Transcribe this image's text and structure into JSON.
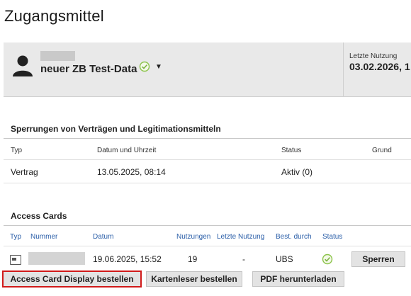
{
  "page": {
    "title": "Zugangsmittel"
  },
  "user_panel": {
    "name": "neuer ZB Test-Data",
    "last_use_label": "Letzte Nutzung",
    "last_use_value": "03.02.2026, 1",
    "colors": {
      "panel_bg": "#e9e9e9",
      "verified": "#8bc34a"
    }
  },
  "sperrungen": {
    "title": "Sperrungen von Verträgen und Legitimationsmitteln",
    "headers": {
      "typ": "Typ",
      "datum": "Datum und Uhrzeit",
      "status": "Status",
      "grund": "Grund"
    },
    "rows": [
      {
        "typ": "Vertrag",
        "datum": "13.05.2025, 08:14",
        "status": "Aktiv (0)",
        "grund": ""
      }
    ]
  },
  "access_cards": {
    "title": "Access Cards",
    "headers": {
      "typ": "Typ",
      "nummer": "Nummer",
      "datum": "Datum",
      "nutzungen": "Nutzungen",
      "letzte_nutzung": "Letzte Nutzung",
      "bestellt_durch": "Best. durch",
      "status": "Status"
    },
    "rows": [
      {
        "typ_icon": "card-icon",
        "nummer": "",
        "datum": "19.06.2025, 15:52",
        "nutzungen": "19",
        "letzte_nutzung": "-",
        "bestellt_durch": "UBS",
        "status_icon": "check-circle-icon",
        "action_label": "Sperren"
      }
    ]
  },
  "actions": {
    "order_display": "Access Card Display bestellen",
    "order_reader": "Kartenleser bestellen",
    "download_pdf": "PDF herunterladen"
  }
}
